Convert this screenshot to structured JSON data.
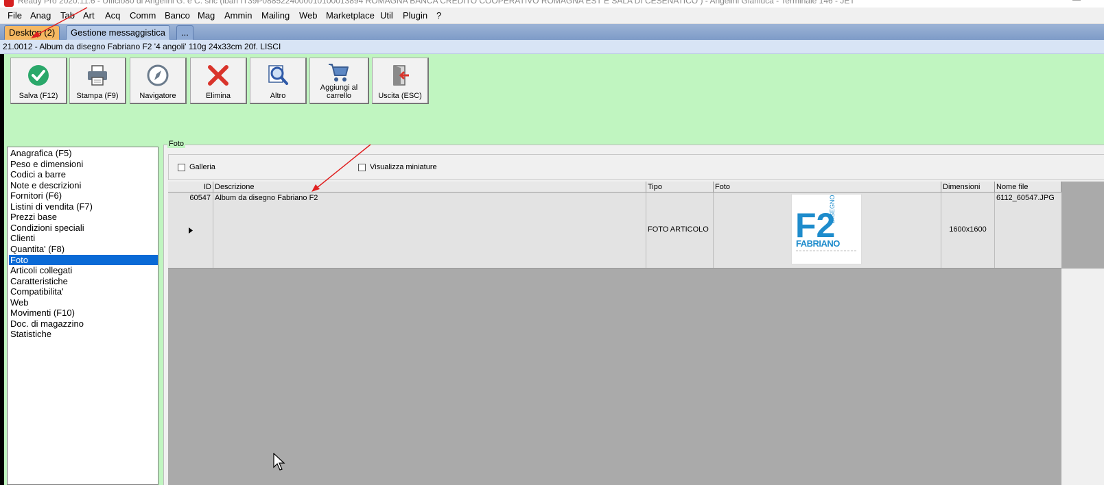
{
  "window": {
    "title": "Ready Pro 2020.11.6 - Ufficio80 di Angelini G. e C. snc (iban IT39P0885224000010100013894  ROMAGNA BANCA CREDITO COOPERATIVO ROMAGNA EST E SALA DI CESENATICO ) - Angelini Gianluca - Terminale 146 - JET",
    "minimize": "—"
  },
  "menu": [
    "File",
    "Anag",
    "Tab",
    "Art",
    "Acq",
    "Comm",
    "Banco",
    "Mag",
    "Ammin",
    "Mailing",
    "Web",
    "Marketplace",
    "Util",
    "Plugin",
    "?"
  ],
  "tabs": {
    "desktop": "Desktop (2)",
    "messaggistica": "Gestione messaggistica",
    "more": "..."
  },
  "record_title": "21.0012 - Album da disegno Fabriano F2 '4 angoli' 110g 24x33cm 20f. LISCI",
  "toolbar": {
    "salva": "Salva (F12)",
    "stampa": "Stampa (F9)",
    "navigatore": "Navigatore",
    "elimina": "Elimina",
    "altro": "Altro",
    "carrello_1": "Aggiungi al",
    "carrello_2": "carrello",
    "uscita": "Uscita (ESC)"
  },
  "nav_items": [
    "Anagrafica (F5)",
    "Peso e dimensioni",
    "Codici a barre",
    "Note e descrizioni",
    "Fornitori (F6)",
    "Listini di vendita (F7)",
    "Prezzi base",
    "Condizioni speciali",
    "Clienti",
    "Quantita' (F8)",
    "Foto",
    "Articoli collegati",
    "Caratteristiche",
    "Compatibilita'",
    "Web",
    "Movimenti (F10)",
    "Doc. di magazzino",
    "Statistiche"
  ],
  "nav_selected": "Foto",
  "foto_panel": {
    "legend": "Foto",
    "galleria": "Galleria",
    "miniature": "Visualizza miniature"
  },
  "grid": {
    "headers": {
      "id": "ID",
      "descrizione": "Descrizione",
      "tipo": "Tipo",
      "foto": "Foto",
      "dimensioni": "Dimensioni",
      "nome_file": "Nome file"
    },
    "row": {
      "id": "60547",
      "descrizione": "Album da disegno Fabriano F2",
      "tipo": "FOTO ARTICOLO",
      "dimensioni": "1600x1600",
      "nome_file": "6112_60547.JPG"
    }
  },
  "thumbnail": {
    "logo_main": "F2",
    "logo_side": "DISEGNO",
    "brand": "FABRIANO",
    "brand_color": "#1e8ccc"
  },
  "colors": {
    "toolbar_bg": "#c0f5c0",
    "active_tab": "#f5b862",
    "selection": "#0a6ad6",
    "annotation_arrow": "#e02020"
  }
}
